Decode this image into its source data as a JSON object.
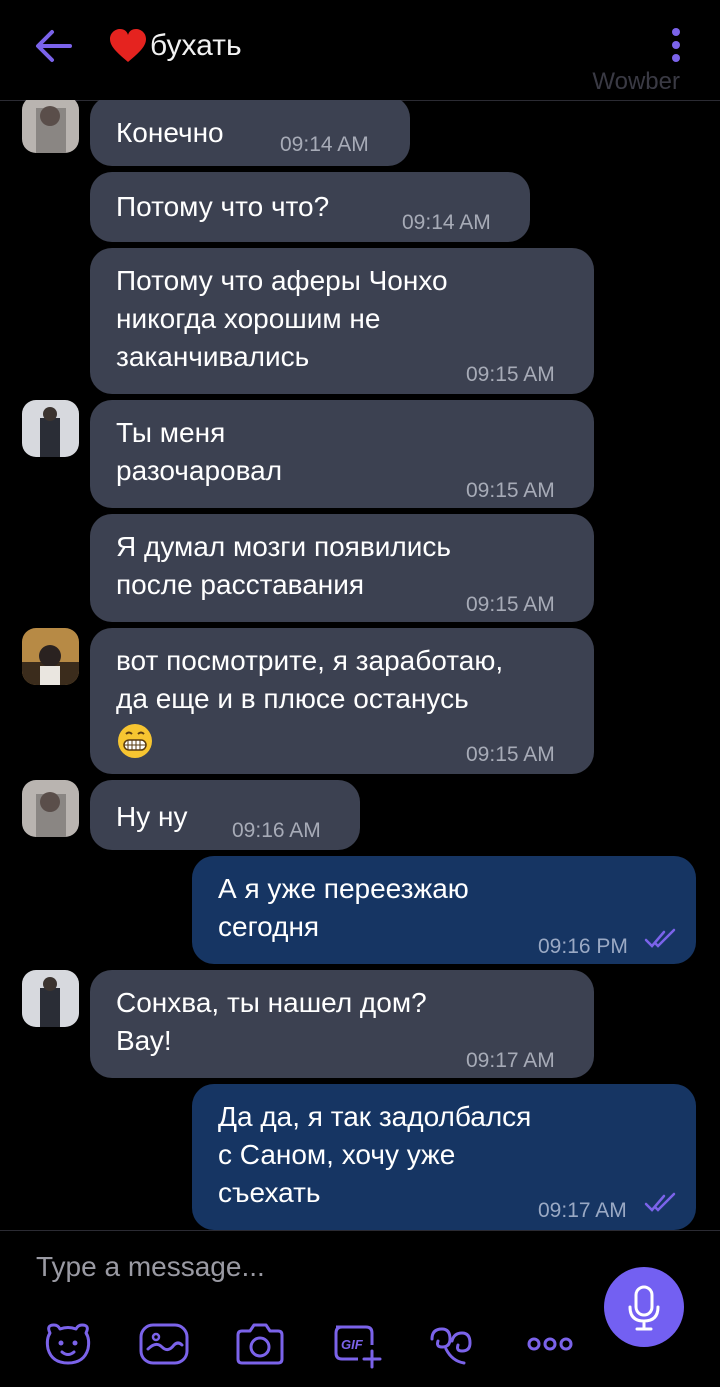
{
  "header": {
    "title": "бухать",
    "watermark": "Wowber"
  },
  "messages": [
    {
      "direction": "in",
      "text": "Конечно",
      "time": "09:14 AM"
    },
    {
      "direction": "in",
      "text": "Потому что что?",
      "time": "09:14 AM"
    },
    {
      "direction": "in",
      "text": "Потому что аферы Чонхо\nникогда хорошим не\nзаканчивались",
      "time": "09:15 AM"
    },
    {
      "direction": "in",
      "text": "Ты меня\nразочаровал",
      "time": "09:15 AM"
    },
    {
      "direction": "in",
      "text": "Я думал мозги появились\nпосле расставания",
      "time": "09:15 AM"
    },
    {
      "direction": "in",
      "text": "вот посмотрите, я заработаю,\nда еще и в плюсе останусь",
      "time": "09:15 AM"
    },
    {
      "direction": "in",
      "text": "Ну ну",
      "time": "09:16 AM"
    },
    {
      "direction": "out",
      "text": "А я уже переезжаю\nсегодня",
      "time": "09:16 PM"
    },
    {
      "direction": "in",
      "text": "Сонхва, ты нашел дом?\nВау!",
      "time": "09:17 AM"
    },
    {
      "direction": "out",
      "text": "Да да, я так задолбался\nс Саном, хочу уже\nсъехать",
      "time": "09:17 AM"
    }
  ],
  "composer": {
    "placeholder": "Type a message...",
    "tools": [
      "sticker-icon",
      "doodle-icon",
      "camera-icon",
      "gif-icon",
      "gesture-icon",
      "more-icon"
    ]
  },
  "colors": {
    "accent": "#7360f2",
    "incoming_bubble": "#3c4151",
    "outgoing_bubble": "#163563",
    "background": "#000000"
  }
}
